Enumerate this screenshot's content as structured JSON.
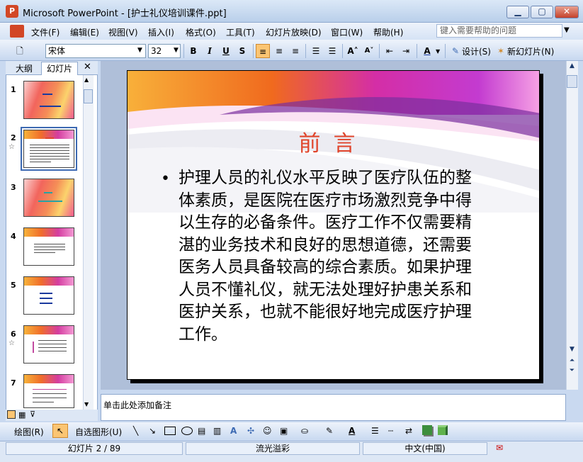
{
  "window": {
    "title": "Microsoft PowerPoint - [护士礼仪培训课件.ppt]",
    "app_icon": "P",
    "minimize": "▁",
    "maximize": "▢",
    "close": "✕"
  },
  "menu": {
    "items": [
      "文件(F)",
      "编辑(E)",
      "视图(V)",
      "插入(I)",
      "格式(O)",
      "工具(T)",
      "幻灯片放映(D)",
      "窗口(W)",
      "帮助(H)"
    ],
    "help_placeholder": "键入需要帮助的问题"
  },
  "toolbar": {
    "font_name": "宋体",
    "font_size": "32",
    "bold": "B",
    "italic": "I",
    "underline": "U",
    "shadow": "S",
    "design_label": "设计(S)",
    "new_slide_label": "新幻灯片(N)"
  },
  "left_pane": {
    "tab_outline": "大纲",
    "tab_slides": "幻灯片",
    "close": "✕",
    "slide_numbers": [
      "1",
      "2",
      "3",
      "4",
      "5",
      "6",
      "7"
    ],
    "selected_index": 2
  },
  "slide": {
    "title": "前言",
    "bullet_char": "•",
    "body": "护理人员的礼仪水平反映了医疗队伍的整体素质，是医院在医疗市场激烈竞争中得以生存的必备条件。医疗工作不仅需要精湛的业务技术和良好的思想道德，还需要医务人员具备较高的综合素质。如果护理人员不懂礼仪，就无法处理好护患关系和医护关系，也就不能很好地完成医疗护理工作。",
    "body_lines": [
      "护理人员的礼仪水平反映了医疗队伍的整",
      "体素质，是医院在医疗市场激烈竞争中得",
      "以生存的必备条件。医疗工作不仅需要精",
      "湛的业务技术和良好的思想道德，还需要",
      "医务人员具备较高的综合素质。如果护理",
      "人员不懂礼仪，就无法处理好护患关系和",
      "医护关系，也就不能很好地完成医疗护理",
      "工作。"
    ]
  },
  "notes": {
    "placeholder": "单击此处添加备注"
  },
  "draw_toolbar": {
    "draw_label": "绘图(R)",
    "autoshape_label": "自选图形(U)"
  },
  "status": {
    "slide_info": "幻灯片 2 / 89",
    "design": "流光溢彩",
    "language": "中文(中国)"
  },
  "colors": {
    "title_red": "#e0452c",
    "accent_blue": "#3d6ab3"
  }
}
